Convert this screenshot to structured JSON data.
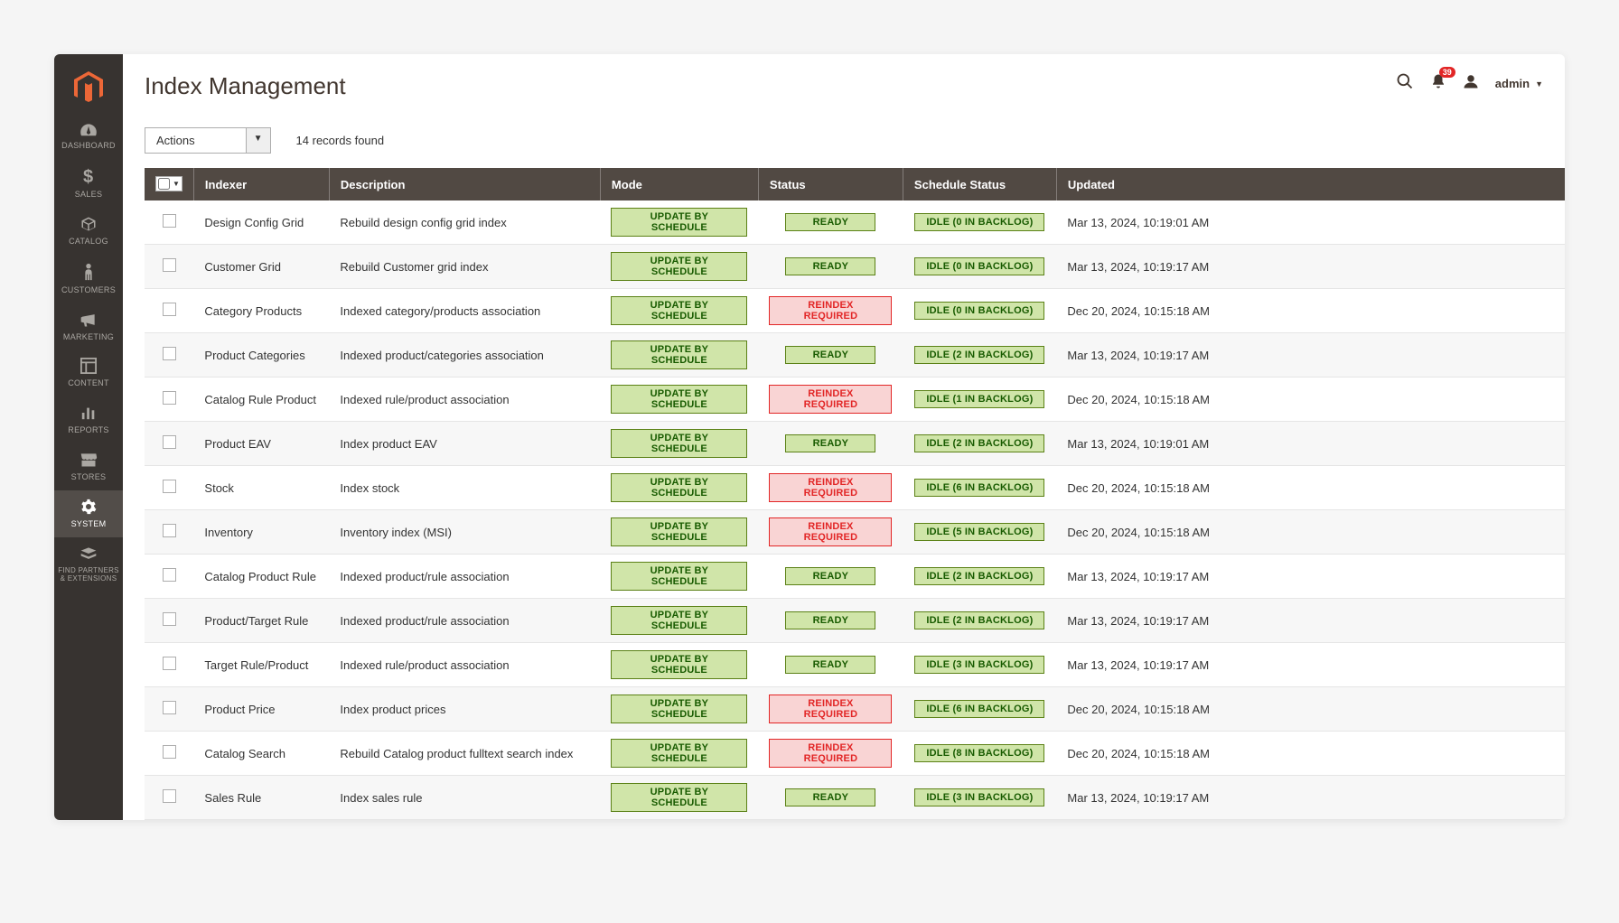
{
  "page_title": "Index Management",
  "notifications_count": "39",
  "user_name": "admin",
  "actions_label": "Actions",
  "records_found": "14 records found",
  "sidebar": [
    {
      "label": "DASHBOARD",
      "icon": "dashboard"
    },
    {
      "label": "SALES",
      "icon": "dollar"
    },
    {
      "label": "CATALOG",
      "icon": "box"
    },
    {
      "label": "CUSTOMERS",
      "icon": "person"
    },
    {
      "label": "MARKETING",
      "icon": "megaphone"
    },
    {
      "label": "CONTENT",
      "icon": "layout"
    },
    {
      "label": "REPORTS",
      "icon": "bars"
    },
    {
      "label": "STORES",
      "icon": "store"
    },
    {
      "label": "SYSTEM",
      "icon": "gear",
      "active": true
    },
    {
      "label": "FIND PARTNERS & EXTENSIONS",
      "icon": "partners"
    }
  ],
  "columns": {
    "indexer": "Indexer",
    "description": "Description",
    "mode": "Mode",
    "status": "Status",
    "schedule": "Schedule Status",
    "updated": "Updated"
  },
  "mode_label": "UPDATE BY SCHEDULE",
  "status_ready": "READY",
  "status_reindex": "REINDEX REQUIRED",
  "rows": [
    {
      "indexer": "Design Config Grid",
      "description": "Rebuild design config grid index",
      "status": "ready",
      "schedule": "IDLE (0 IN BACKLOG)",
      "updated": "Mar 13, 2024, 10:19:01 AM"
    },
    {
      "indexer": "Customer Grid",
      "description": "Rebuild Customer grid index",
      "status": "ready",
      "schedule": "IDLE (0 IN BACKLOG)",
      "updated": "Mar 13, 2024, 10:19:17 AM"
    },
    {
      "indexer": "Category Products",
      "description": "Indexed category/products association",
      "status": "reindex",
      "schedule": "IDLE (0 IN BACKLOG)",
      "updated": "Dec 20, 2024, 10:15:18 AM"
    },
    {
      "indexer": "Product Categories",
      "description": "Indexed product/categories association",
      "status": "ready",
      "schedule": "IDLE (2 IN BACKLOG)",
      "updated": "Mar 13, 2024, 10:19:17 AM"
    },
    {
      "indexer": "Catalog Rule Product",
      "description": "Indexed rule/product association",
      "status": "reindex",
      "schedule": "IDLE (1 IN BACKLOG)",
      "updated": "Dec 20, 2024, 10:15:18 AM"
    },
    {
      "indexer": "Product EAV",
      "description": "Index product EAV",
      "status": "ready",
      "schedule": "IDLE (2 IN BACKLOG)",
      "updated": "Mar 13, 2024, 10:19:01 AM"
    },
    {
      "indexer": "Stock",
      "description": "Index stock",
      "status": "reindex",
      "schedule": "IDLE (6 IN BACKLOG)",
      "updated": "Dec 20, 2024, 10:15:18 AM"
    },
    {
      "indexer": "Inventory",
      "description": "Inventory index (MSI)",
      "status": "reindex",
      "schedule": "IDLE (5 IN BACKLOG)",
      "updated": "Dec 20, 2024, 10:15:18 AM"
    },
    {
      "indexer": "Catalog Product Rule",
      "description": "Indexed product/rule association",
      "status": "ready",
      "schedule": "IDLE (2 IN BACKLOG)",
      "updated": "Mar 13, 2024, 10:19:17 AM"
    },
    {
      "indexer": "Product/Target Rule",
      "description": "Indexed product/rule association",
      "status": "ready",
      "schedule": "IDLE (2 IN BACKLOG)",
      "updated": "Mar 13, 2024, 10:19:17 AM"
    },
    {
      "indexer": "Target Rule/Product",
      "description": "Indexed rule/product association",
      "status": "ready",
      "schedule": "IDLE (3 IN BACKLOG)",
      "updated": "Mar 13, 2024, 10:19:17 AM"
    },
    {
      "indexer": "Product Price",
      "description": "Index product prices",
      "status": "reindex",
      "schedule": "IDLE (6 IN BACKLOG)",
      "updated": "Dec 20, 2024, 10:15:18 AM"
    },
    {
      "indexer": "Catalog Search",
      "description": "Rebuild Catalog product fulltext search index",
      "status": "reindex",
      "schedule": "IDLE (8 IN BACKLOG)",
      "updated": "Dec 20, 2024, 10:15:18 AM"
    },
    {
      "indexer": "Sales Rule",
      "description": "Index sales rule",
      "status": "ready",
      "schedule": "IDLE (3 IN BACKLOG)",
      "updated": "Mar 13, 2024, 10:19:17 AM"
    }
  ]
}
